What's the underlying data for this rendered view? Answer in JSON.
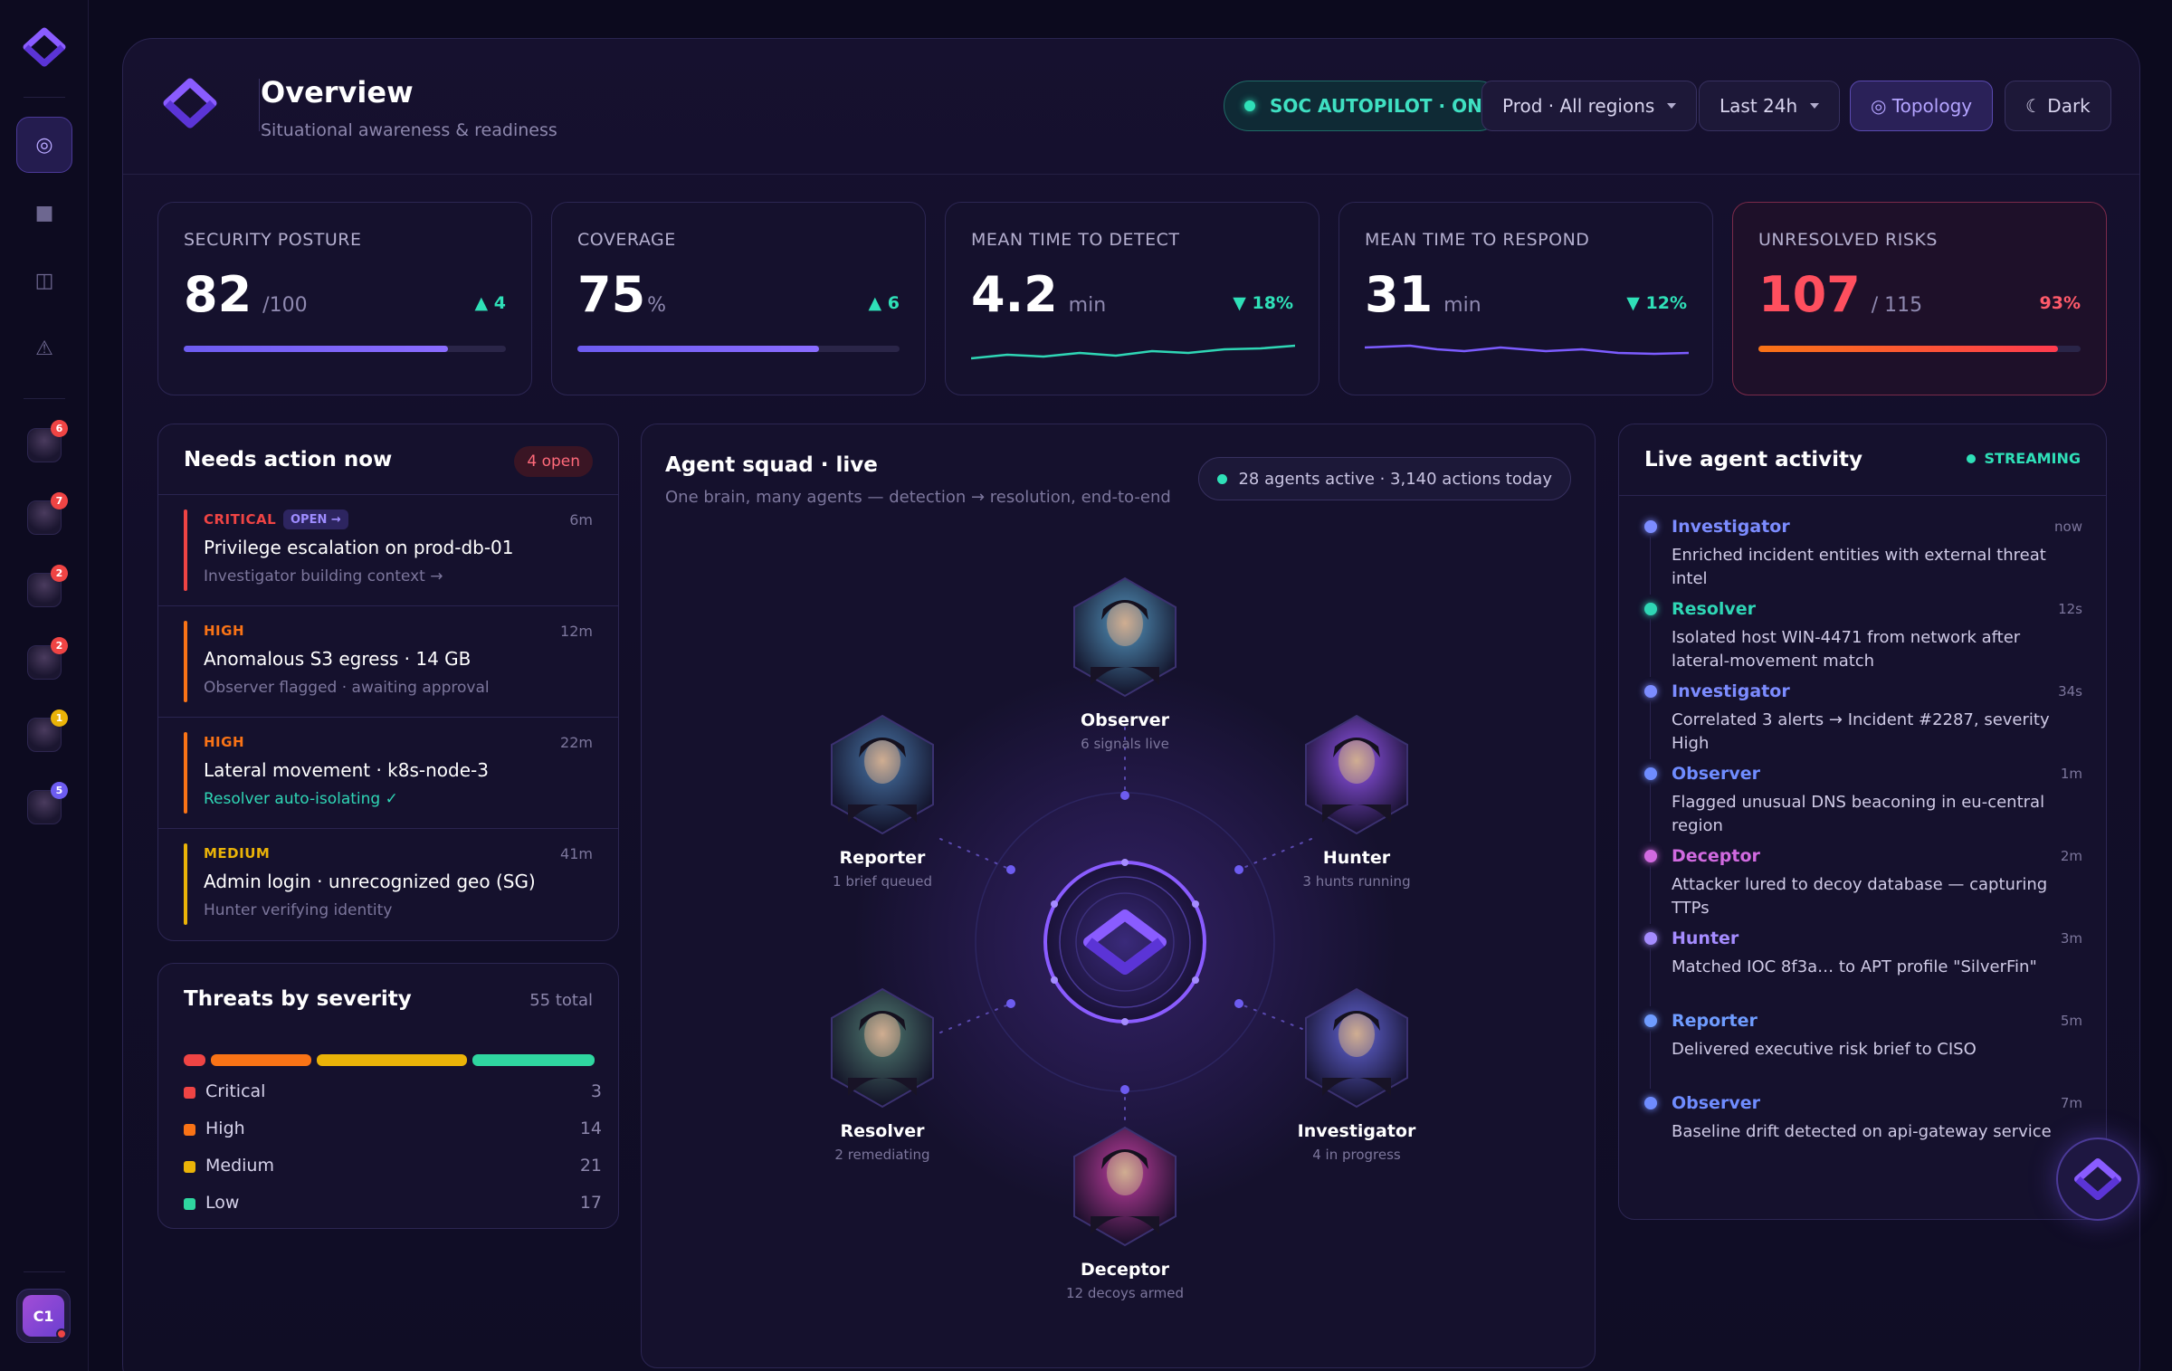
{
  "header": {
    "title": "Overview",
    "subtitle": "Situational awareness & readiness",
    "autopilot": "SOC AUTOPILOT · ON",
    "region": "Prod · All regions",
    "range": "Last 24h",
    "topology": "◎ Topology",
    "theme": "☾ Dark"
  },
  "sidebar": {
    "nav": [
      {
        "icon": "target-icon",
        "glyph": "◎",
        "active": true
      },
      {
        "icon": "square-icon",
        "glyph": "■",
        "active": false
      },
      {
        "icon": "columns-icon",
        "glyph": "◫",
        "active": false
      },
      {
        "icon": "warning-icon",
        "glyph": "⚠",
        "active": false
      }
    ],
    "agents": [
      {
        "badge": "6",
        "color": "#ef4444"
      },
      {
        "badge": "7",
        "color": "#ef4444"
      },
      {
        "badge": "2",
        "color": "#ef4444"
      },
      {
        "badge": "2",
        "color": "#ef4444"
      },
      {
        "badge": "1",
        "color": "#eab308"
      },
      {
        "badge": "5",
        "color": "#6d5cf0"
      }
    ],
    "user_initials": "C1"
  },
  "kpis": [
    {
      "label": "SECURITY POSTURE",
      "value": "82",
      "unit": "/100",
      "delta": "▲ 4",
      "progress": 0.82,
      "color": "#7c5cff"
    },
    {
      "label": "COVERAGE",
      "value": "75",
      "unit": "%",
      "delta": "▲ 6",
      "progress": 0.75,
      "color": "#7c5cff"
    },
    {
      "label": "MEAN TIME TO DETECT",
      "value": "4.2",
      "unit": "min",
      "delta": "▼ 18%",
      "spark_color": "#2fd6b5"
    },
    {
      "label": "MEAN TIME TO RESPOND",
      "value": "31",
      "unit": "min",
      "delta": "▼ 12%",
      "spark_color": "#7c5cff"
    },
    {
      "label": "UNRESOLVED RISKS",
      "value": "107",
      "unit": "/ 115",
      "delta": "93%",
      "progress": 0.93,
      "color": "#ff4f5e"
    }
  ],
  "needs_action": {
    "title": "Needs action now",
    "count": "4 open",
    "open_label": "OPEN →",
    "items": [
      {
        "severity": "CRITICAL",
        "time": "6m",
        "name": "Privilege escalation on prod-db-01",
        "note": "Investigator building context →",
        "color": "#ef4444",
        "note_color": "#7c769c"
      },
      {
        "severity": "HIGH",
        "time": "12m",
        "name": "Anomalous S3 egress · 14 GB",
        "note": "Observer flagged · awaiting approval",
        "color": "#f97316",
        "note_color": "#7c769c"
      },
      {
        "severity": "HIGH",
        "time": "22m",
        "name": "Lateral movement · k8s-node-3",
        "note": "Resolver auto-isolating ✓",
        "color": "#f97316",
        "note_color": "#2fd6b5"
      },
      {
        "severity": "MEDIUM",
        "time": "41m",
        "name": "Admin login · unrecognized geo (SG)",
        "note": "Hunter verifying identity",
        "color": "#eab308",
        "note_color": "#7c769c"
      }
    ]
  },
  "threats": {
    "title": "Threats by severity",
    "total": "55 total",
    "rows": [
      {
        "label": "Critical",
        "count": 3,
        "color": "#ef4444"
      },
      {
        "label": "High",
        "count": 14,
        "color": "#f97316"
      },
      {
        "label": "Medium",
        "count": 21,
        "color": "#eab308"
      },
      {
        "label": "Low",
        "count": 17,
        "color": "#2fd6a0"
      }
    ]
  },
  "squad": {
    "title": "Agent squad · live",
    "subtitle": "One brain, many agents — detection → resolution, end-to-end",
    "status": "28 agents active · 3,140 actions today",
    "agents": [
      {
        "name": "Observer",
        "meta": "6 signals live",
        "hue": "#3f6b8e"
      },
      {
        "name": "Reporter",
        "meta": "1 brief queued",
        "hue": "#37557e"
      },
      {
        "name": "Hunter",
        "meta": "3 hunts running",
        "hue": "#6b3fb0"
      },
      {
        "name": "Resolver",
        "meta": "2 remediating",
        "hue": "#3d5a5a"
      },
      {
        "name": "Investigator",
        "meta": "4 in progress",
        "hue": "#4a4aa0"
      },
      {
        "name": "Deceptor",
        "meta": "12 decoys armed",
        "hue": "#8a2f7a"
      }
    ]
  },
  "activity": {
    "title": "Live agent activity",
    "status": "STREAMING",
    "items": [
      {
        "who": "Investigator",
        "when": "now",
        "what": "Enriched incident entities with external threat intel",
        "color": "#7c8cff"
      },
      {
        "who": "Resolver",
        "when": "12s",
        "what": "Isolated host WIN-4471 from network after lateral-movement match",
        "color": "#2fd6b5"
      },
      {
        "who": "Investigator",
        "when": "34s",
        "what": "Correlated 3 alerts → Incident #2287, severity High",
        "color": "#7c8cff"
      },
      {
        "who": "Observer",
        "when": "1m",
        "what": "Flagged unusual DNS beaconing in eu-central region",
        "color": "#6f8cff"
      },
      {
        "who": "Deceptor",
        "when": "2m",
        "what": "Attacker lured to decoy database — capturing TTPs",
        "color": "#d16ae0"
      },
      {
        "who": "Hunter",
        "when": "3m",
        "what": "Matched IOC 8f3a… to APT profile \"SilverFin\"",
        "color": "#a58cff"
      },
      {
        "who": "Reporter",
        "when": "5m",
        "what": "Delivered executive risk brief to CISO",
        "color": "#6f9cff"
      },
      {
        "who": "Observer",
        "when": "7m",
        "what": "Baseline drift detected on api-gateway service",
        "color": "#6f8cff"
      }
    ]
  }
}
